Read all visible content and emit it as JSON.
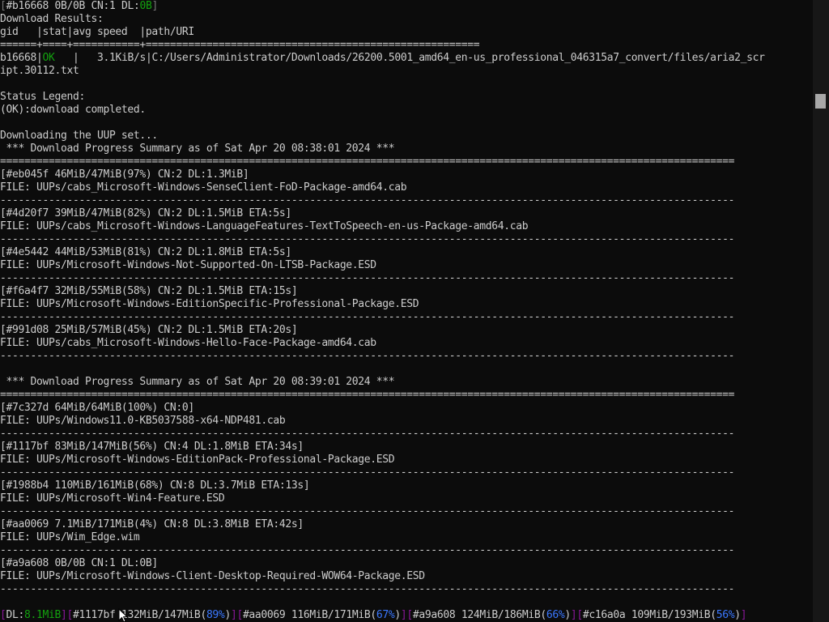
{
  "terminal": {
    "header": {
      "gid": "b16668",
      "progress": "0B/0B",
      "cn": "CN:1",
      "dl_label": "DL:",
      "dl_value": "0B"
    },
    "results": {
      "title": "Download Results:",
      "columns_line": "gid   |stat|avg speed  |path/URI",
      "separator": "======+====+===========+=======================================================",
      "row": {
        "gid": "b16668",
        "stat": "OK",
        "pad": "   |   ",
        "speed": "3.1KiB/s",
        "path_line1": "C:/Users/Administrator/Downloads/26200.5001_amd64_en-us_professional_046315a7_convert/files/aria2_scr",
        "path_line2": "ipt.30112.txt"
      }
    },
    "legend": {
      "title": "Status Legend:",
      "ok": "(OK):download completed."
    },
    "downloading_msg": "Downloading the UUP set...",
    "summaries": [
      {
        "title": " *** Download Progress Summary as of Sat Apr 20 08:38:01 2024 ***",
        "items": [
          {
            "status": "[#eb045f 46MiB/47MiB(97%) CN:2 DL:1.3MiB]",
            "file": "FILE: UUPs/cabs_Microsoft-Windows-SenseClient-FoD-Package-amd64.cab"
          },
          {
            "status": "[#4d20f7 39MiB/47MiB(82%) CN:2 DL:1.5MiB ETA:5s]",
            "file": "FILE: UUPs/cabs_Microsoft-Windows-LanguageFeatures-TextToSpeech-en-us-Package-amd64.cab"
          },
          {
            "status": "[#4e5442 44MiB/53MiB(81%) CN:2 DL:1.8MiB ETA:5s]",
            "file": "FILE: UUPs/Microsoft-Windows-Not-Supported-On-LTSB-Package.ESD"
          },
          {
            "status": "[#f6a4f7 32MiB/55MiB(58%) CN:2 DL:1.5MiB ETA:15s]",
            "file": "FILE: UUPs/Microsoft-Windows-EditionSpecific-Professional-Package.ESD"
          },
          {
            "status": "[#991d08 25MiB/57MiB(45%) CN:2 DL:1.5MiB ETA:20s]",
            "file": "FILE: UUPs/cabs_Microsoft-Windows-Hello-Face-Package-amd64.cab"
          }
        ]
      },
      {
        "title": " *** Download Progress Summary as of Sat Apr 20 08:39:01 2024 ***",
        "items": [
          {
            "status": "[#7c327d 64MiB/64MiB(100%) CN:0]",
            "file": "FILE: UUPs/Windows11.0-KB5037588-x64-NDP481.cab"
          },
          {
            "status": "[#1117bf 83MiB/147MiB(56%) CN:4 DL:1.8MiB ETA:34s]",
            "file": "FILE: UUPs/Microsoft-Windows-EditionPack-Professional-Package.ESD"
          },
          {
            "status": "[#1988b4 110MiB/161MiB(68%) CN:8 DL:3.7MiB ETA:13s]",
            "file": "FILE: UUPs/Microsoft-Win4-Feature.ESD"
          },
          {
            "status": "[#aa0069 7.1MiB/171MiB(4%) CN:8 DL:3.8MiB ETA:42s]",
            "file": "FILE: UUPs/Wim_Edge.wim"
          },
          {
            "status": "[#a9a608 0B/0B CN:1 DL:0B]",
            "file": "FILE: UUPs/Microsoft-Windows-Client-Desktop-Required-WOW64-Package.ESD"
          }
        ]
      }
    ],
    "double_rule": "=========================================================================================================================",
    "single_rule": "-------------------------------------------------------------------------------------------------------------------------",
    "statusline": {
      "dl_label": "DL:",
      "dl_value": "8.1MiB",
      "jobs": [
        {
          "gid": "#1117bf",
          "progress": "132MiB/147MiB",
          "pct": "89%"
        },
        {
          "gid": "#aa0069",
          "progress": "116MiB/171MiB",
          "pct": "67%"
        },
        {
          "gid": "#a9a608",
          "progress": "124MiB/186MiB",
          "pct": "66%"
        },
        {
          "gid": "#c16a0a",
          "progress": "109MiB/193MiB",
          "pct": "56%"
        }
      ]
    }
  },
  "colors": {
    "background": "#0c0c0c",
    "text": "#cccccc",
    "bracket": "#767676",
    "green": "#13a10e",
    "purple": "#881798",
    "blue": "#3b78ff",
    "scrollbar_track": "#171717",
    "scrollbar_thumb": "#a8a8a8"
  }
}
